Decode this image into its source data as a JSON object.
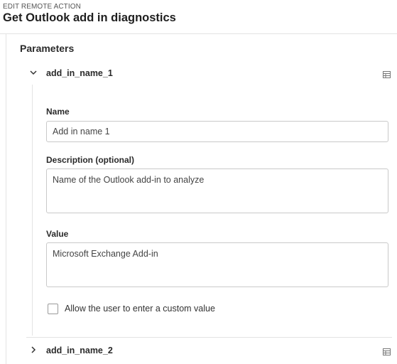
{
  "header": {
    "eyebrow": "EDIT REMOTE ACTION",
    "title": "Get Outlook add in diagnostics"
  },
  "parameters": {
    "section_title": "Parameters",
    "items": [
      {
        "name": "add_in_name_1",
        "expanded": true,
        "expand_icon": "chevron-down-icon",
        "row_icon": "table-icon",
        "fields": {
          "name_label": "Name",
          "name_value": "Add in name 1",
          "description_label": "Description (optional)",
          "description_value": "Name of the Outlook add-in to analyze",
          "value_label": "Value",
          "value_value": "Microsoft Exchange Add-in",
          "allow_custom_label": "Allow the user to enter a custom value",
          "allow_custom_checked": false
        }
      },
      {
        "name": "add_in_name_2",
        "expanded": false,
        "expand_icon": "chevron-right-icon",
        "row_icon": "table-icon"
      }
    ]
  },
  "colors": {
    "border": "#e3e3e3",
    "input_border": "#c9c9c9",
    "text": "#222222"
  }
}
